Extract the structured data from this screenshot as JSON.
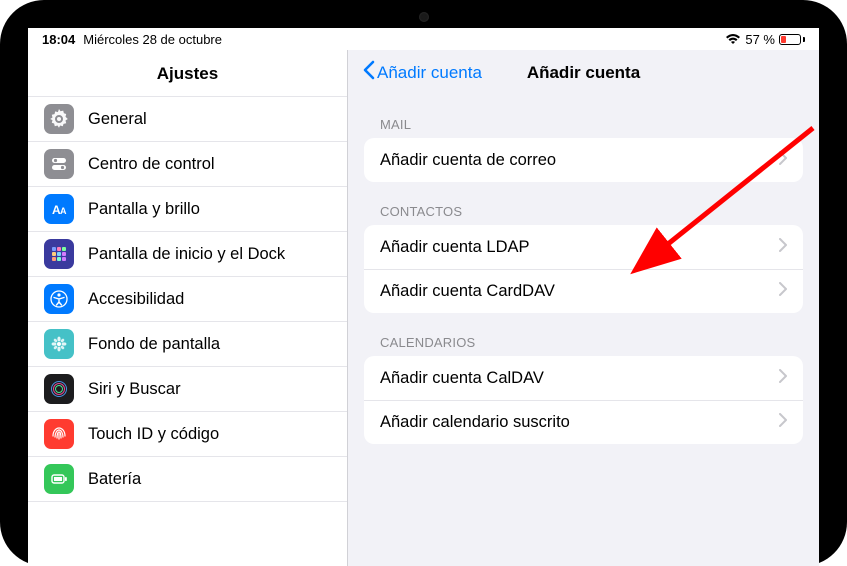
{
  "status": {
    "time": "18:04",
    "date": "Miércoles 28 de octubre",
    "battery_pct": "57 %",
    "battery_fill_pct": 25,
    "battery_color": "#ff3b30"
  },
  "sidebar": {
    "title": "Ajustes",
    "items": [
      {
        "label": "General",
        "icon": "gear"
      },
      {
        "label": "Centro de control",
        "icon": "toggles"
      },
      {
        "label": "Pantalla y brillo",
        "icon": "aa"
      },
      {
        "label": "Pantalla de inicio y el Dock",
        "icon": "grid"
      },
      {
        "label": "Accesibilidad",
        "icon": "person"
      },
      {
        "label": "Fondo de pantalla",
        "icon": "flower"
      },
      {
        "label": "Siri y Buscar",
        "icon": "siri"
      },
      {
        "label": "Touch ID y código",
        "icon": "fingerprint"
      },
      {
        "label": "Batería",
        "icon": "battery"
      }
    ]
  },
  "detail": {
    "back_label": "Añadir cuenta",
    "title": "Añadir cuenta",
    "sections": [
      {
        "header": "MAIL",
        "rows": [
          {
            "label": "Añadir cuenta de correo"
          }
        ]
      },
      {
        "header": "CONTACTOS",
        "rows": [
          {
            "label": "Añadir cuenta LDAP"
          },
          {
            "label": "Añadir cuenta CardDAV"
          }
        ]
      },
      {
        "header": "CALENDARIOS",
        "rows": [
          {
            "label": "Añadir cuenta CalDAV"
          },
          {
            "label": "Añadir calendario suscrito"
          }
        ]
      }
    ]
  },
  "annotation": {
    "arrow_color": "#ff0000"
  }
}
